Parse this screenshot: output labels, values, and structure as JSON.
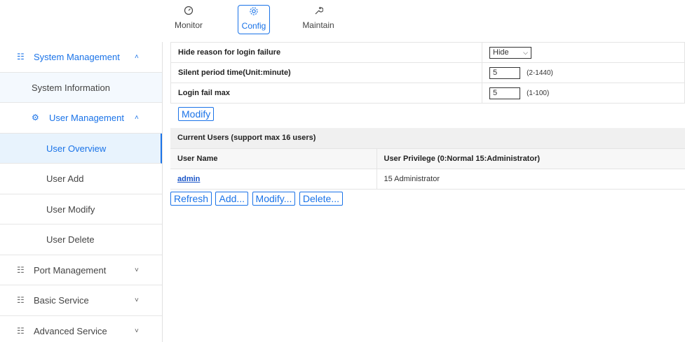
{
  "topnav": {
    "monitor": "Monitor",
    "config": "Config",
    "maintain": "Maintain"
  },
  "sidebar": {
    "system_management": "System Management",
    "system_information": "System Information",
    "user_management": "User Management",
    "user_overview": "User Overview",
    "user_add": "User Add",
    "user_modify": "User Modify",
    "user_delete": "User Delete",
    "port_management": "Port Management",
    "basic_service": "Basic Service",
    "advanced_service": "Advanced Service"
  },
  "form": {
    "hide_reason_label": "Hide reason for login failure",
    "hide_reason_value": "Hide",
    "silent_period_label": "Silent period time(Unit:minute)",
    "silent_period_value": "5",
    "silent_period_range": "(2-1440)",
    "login_fail_label": "Login fail max",
    "login_fail_value": "5",
    "login_fail_range": "(1-100)",
    "modify_button": "Modify"
  },
  "users": {
    "section_title": "Current Users (support max 16 users)",
    "col_name": "User Name",
    "col_privilege": "User Privilege (0:Normal 15:Administrator)",
    "rows": [
      {
        "name": "admin",
        "privilege": "15 Administrator"
      }
    ]
  },
  "actions": {
    "refresh": "Refresh",
    "add": "Add...",
    "modify": "Modify...",
    "delete": "Delete..."
  },
  "colors": {
    "accent": "#1a73e8",
    "selected_bg": "#e8f3fd"
  }
}
